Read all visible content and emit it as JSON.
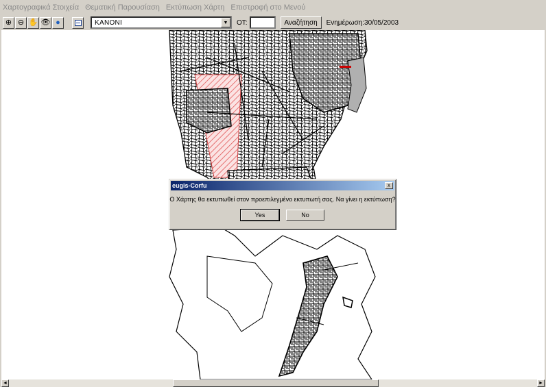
{
  "menu": [
    "Χαρτογραφικά Στοιχεία",
    "Θεματική Παρουσίαση",
    "Εκτύπωση Χάρτη",
    "Επιστροφή στο Μενού"
  ],
  "toolbar": {
    "zoom_in_symbol": "⊕",
    "zoom_out_symbol": "⊖",
    "pan_symbol": "✋",
    "find_symbol": "👁",
    "globe_symbol": "●",
    "area_value": "ΚΑΝΟΝΙ",
    "dropdown_symbol": "▼",
    "of_label": "ΟΤ:",
    "of_value": "",
    "search_label": "Αναζήτηση",
    "updated_text": "Ενημέρωση:30/05/2003"
  },
  "dialog": {
    "title": "eugis-Corfu",
    "close_symbol": "x",
    "message": "Ο Χάρτης θα εκτυπωθεί στον προεπιλεγμένο εκτυπωτή σας. Να γίνει η εκτύπωση?",
    "yes_label": "Yes",
    "no_label": "No"
  },
  "scrollbar": {
    "left_symbol": "◄",
    "right_symbol": "►"
  },
  "icons": [
    "zoom-in-icon",
    "zoom-out-icon",
    "pan-hand-icon",
    "binoculars-icon",
    "globe-icon",
    "layer-icon",
    "dropdown-arrow-icon",
    "close-icon",
    "scroll-left-icon",
    "scroll-right-icon"
  ],
  "colors": {
    "title_bar": "#0a246a",
    "hatch_area": "#e05050",
    "highlight_parcel": "#cc0000",
    "gray_area": "#b0b0b0"
  }
}
